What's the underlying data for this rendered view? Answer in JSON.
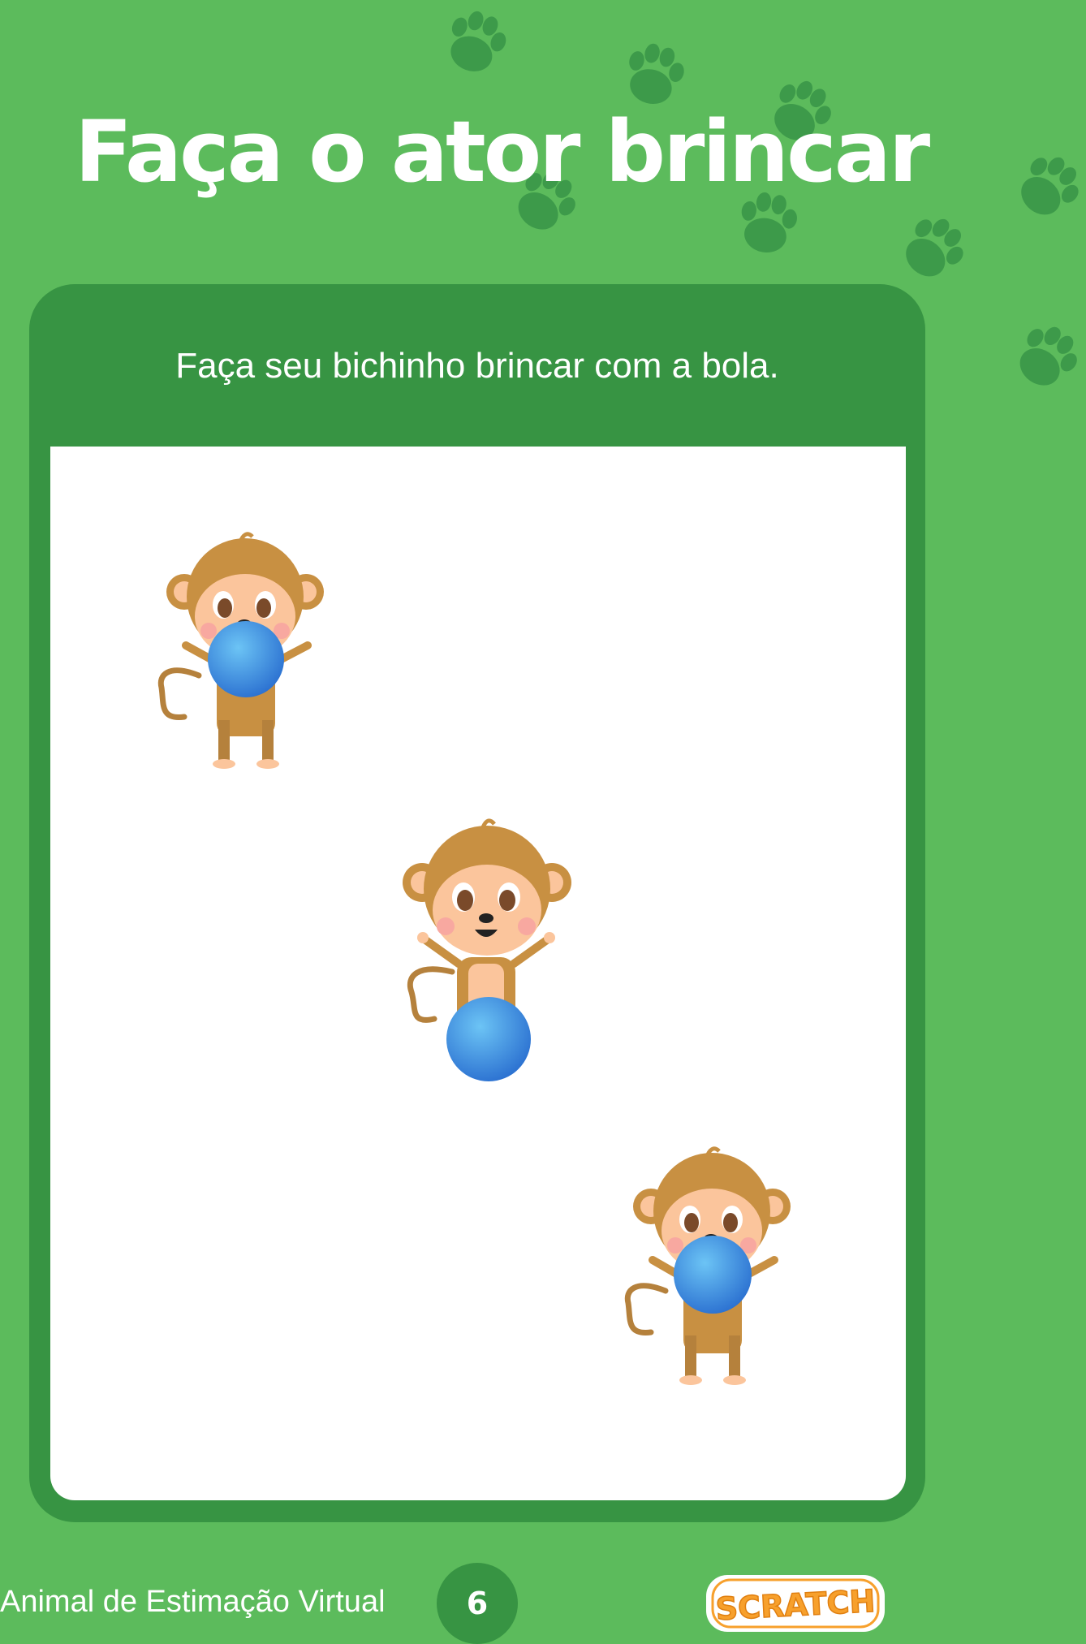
{
  "title": "Faça o ator brincar",
  "card": {
    "instruction": "Faça seu bichinho brincar com a bola."
  },
  "sprites": [
    {
      "icon": "monkey-holding-ball-icon",
      "pose": "ball-at-chest"
    },
    {
      "icon": "monkey-holding-ball-icon",
      "pose": "ball-at-feet"
    },
    {
      "icon": "monkey-holding-ball-icon",
      "pose": "ball-at-chest"
    }
  ],
  "footer": {
    "project_name": "Animal de Estimação Virtual",
    "page_number": "6",
    "logo_text": "SCRATCH"
  },
  "colors": {
    "background": "#5cbb5c",
    "card": "#379443",
    "paw": "#3d9a4a",
    "ball": "#3a8fe0",
    "logo_orange": "#f7a02c"
  }
}
